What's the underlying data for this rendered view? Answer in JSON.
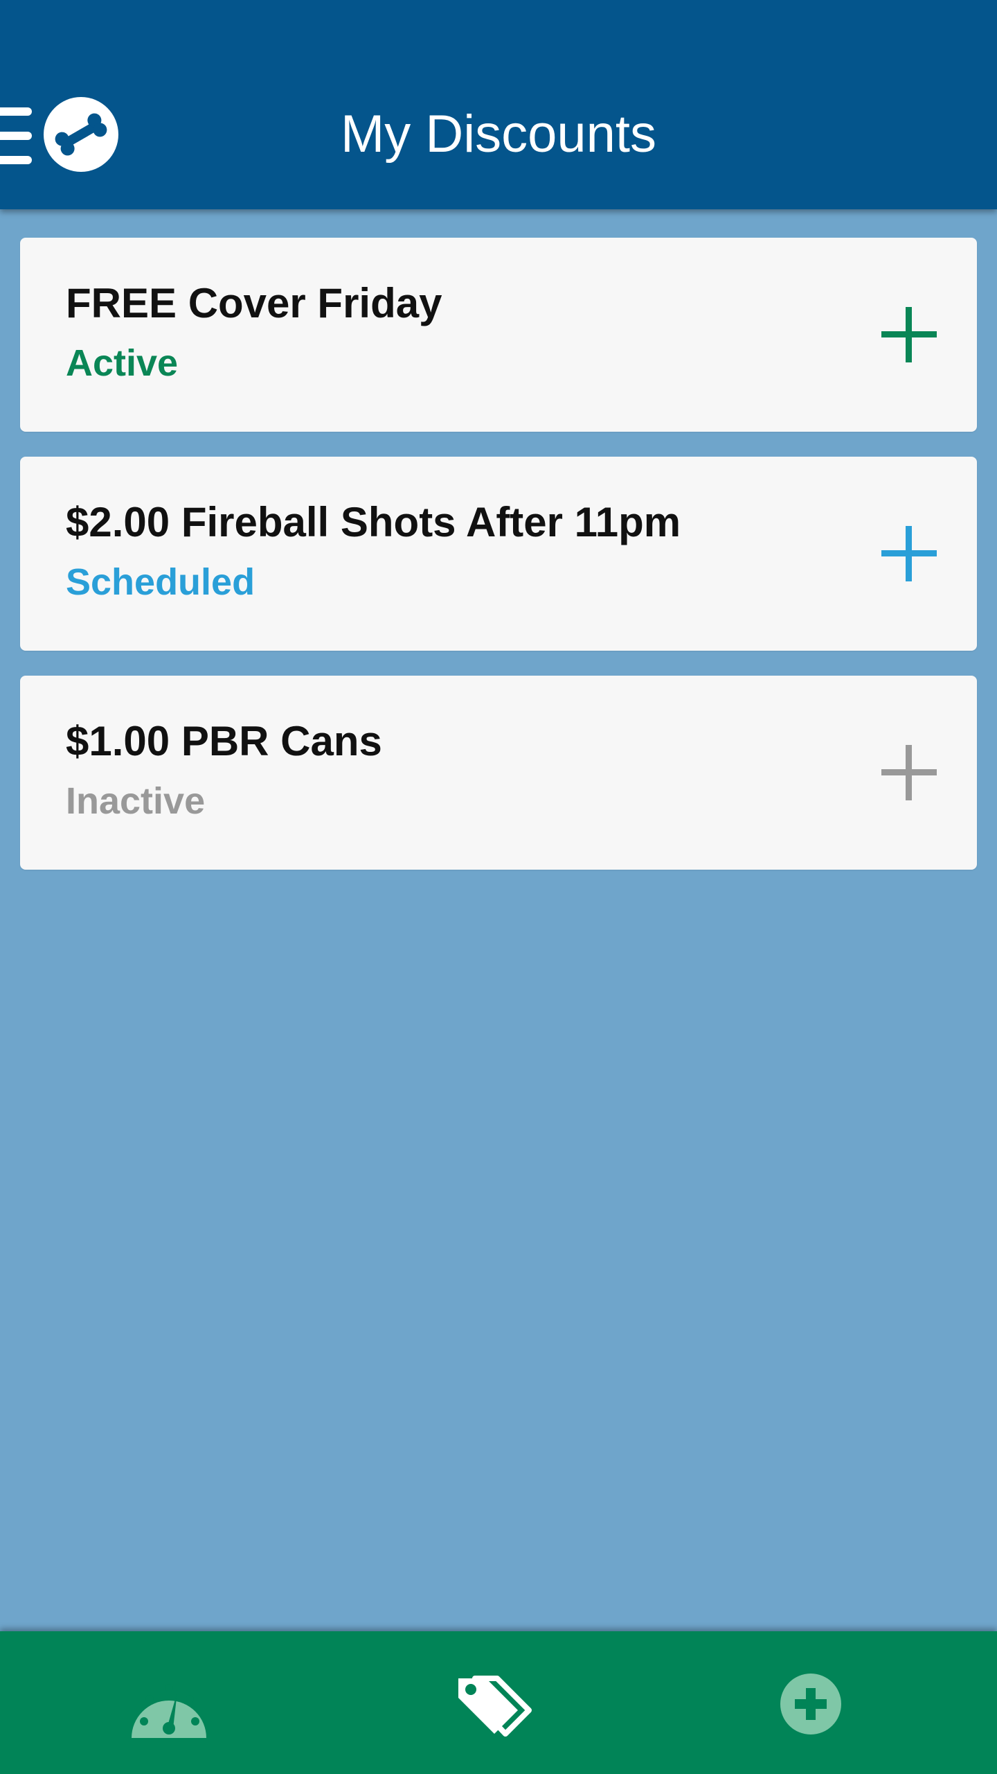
{
  "header": {
    "title": "My Discounts",
    "menu_icon": "hamburger-menu-icon",
    "logo_icon": "bone-logo-icon"
  },
  "discounts": [
    {
      "title": "FREE Cover Friday",
      "status": "Active",
      "status_color": "#0a8656",
      "action_icon": "plus-icon"
    },
    {
      "title": "$2.00 Fireball Shots After 11pm",
      "status": "Scheduled",
      "status_color": "#2a9fd8",
      "action_icon": "plus-icon"
    },
    {
      "title": "$1.00 PBR Cans",
      "status": "Inactive",
      "status_color": "#999999",
      "action_icon": "plus-icon"
    }
  ],
  "bottom_nav": {
    "items": [
      {
        "icon": "dashboard-gauge-icon",
        "active": false
      },
      {
        "icon": "tags-icon",
        "active": true
      },
      {
        "icon": "add-circle-icon",
        "active": false
      }
    ]
  },
  "colors": {
    "app_bar": "#04558c",
    "background": "#6fa5cb",
    "card": "#f7f7f7",
    "bottom_nav": "#018457"
  }
}
